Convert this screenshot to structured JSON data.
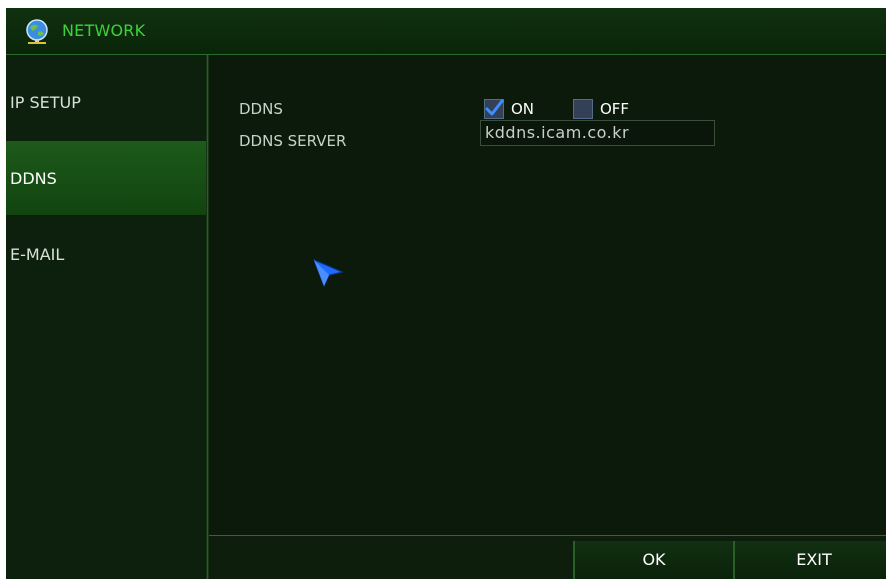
{
  "window": {
    "title": "NETWORK",
    "icon": "globe-network-icon"
  },
  "sidebar": {
    "items": [
      {
        "label": "IP SETUP",
        "active": false
      },
      {
        "label": "DDNS",
        "active": true
      },
      {
        "label": "E-MAIL",
        "active": false
      }
    ]
  },
  "ddns": {
    "label": "DDNS",
    "on_label": "ON",
    "off_label": "OFF",
    "selected": "ON",
    "server_label": "DDNS SERVER",
    "server_value": "kddns.icam.co.kr"
  },
  "buttons": {
    "ok": "OK",
    "exit": "EXIT"
  },
  "colors": {
    "title_text": "#3ed13a",
    "active_item": "#1d5a1b",
    "background": "#0b1a0b",
    "checkbox": "#334055",
    "check_mark": "#3d8eff",
    "cursor": "#1f6bff"
  }
}
